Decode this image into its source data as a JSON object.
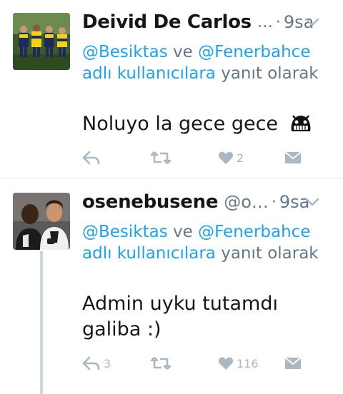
{
  "tweets": [
    {
      "name": "Deivid De Carlos",
      "handle": "",
      "ellipsis": "…",
      "dot": "·",
      "time": "9sa",
      "reply_mention_1": "@Besiktas",
      "reply_joiner": "ve",
      "reply_mention_2": "@Fenerbahce",
      "reply_users_text": "adlı kullanıcılara",
      "reply_suffix": "yanıt olarak",
      "text": "Noluyo la gece gece",
      "emoji": "alien-grin-emoji",
      "reply_count": "",
      "retweet_count": "",
      "like_count": "2",
      "avatar": "team-photo-yellow-black"
    },
    {
      "name": "osenebusene",
      "handle": "@o…",
      "ellipsis": "",
      "dot": "·",
      "time": "9sa",
      "reply_mention_1": "@Besiktas",
      "reply_joiner": "ve",
      "reply_mention_2": "@Fenerbahce",
      "reply_users_text": "adlı kullanıcılara",
      "reply_suffix": "yanıt olarak",
      "text_line_1": "Admin uyku tutamdı",
      "text_line_2": "galiba :)",
      "reply_count": "3",
      "retweet_count": "",
      "like_count": "116",
      "avatar": "two-players-black-white"
    }
  ],
  "colors": {
    "link": "#1da1f2",
    "muted": "#657786",
    "icon": "#aab8c2",
    "divider": "#e1e8ed",
    "thread": "#ccd6dd"
  },
  "icons": {
    "reply": "reply-icon",
    "retweet": "retweet-icon",
    "like": "heart-icon",
    "dm": "envelope-icon",
    "menu": "chevron-down-icon"
  }
}
